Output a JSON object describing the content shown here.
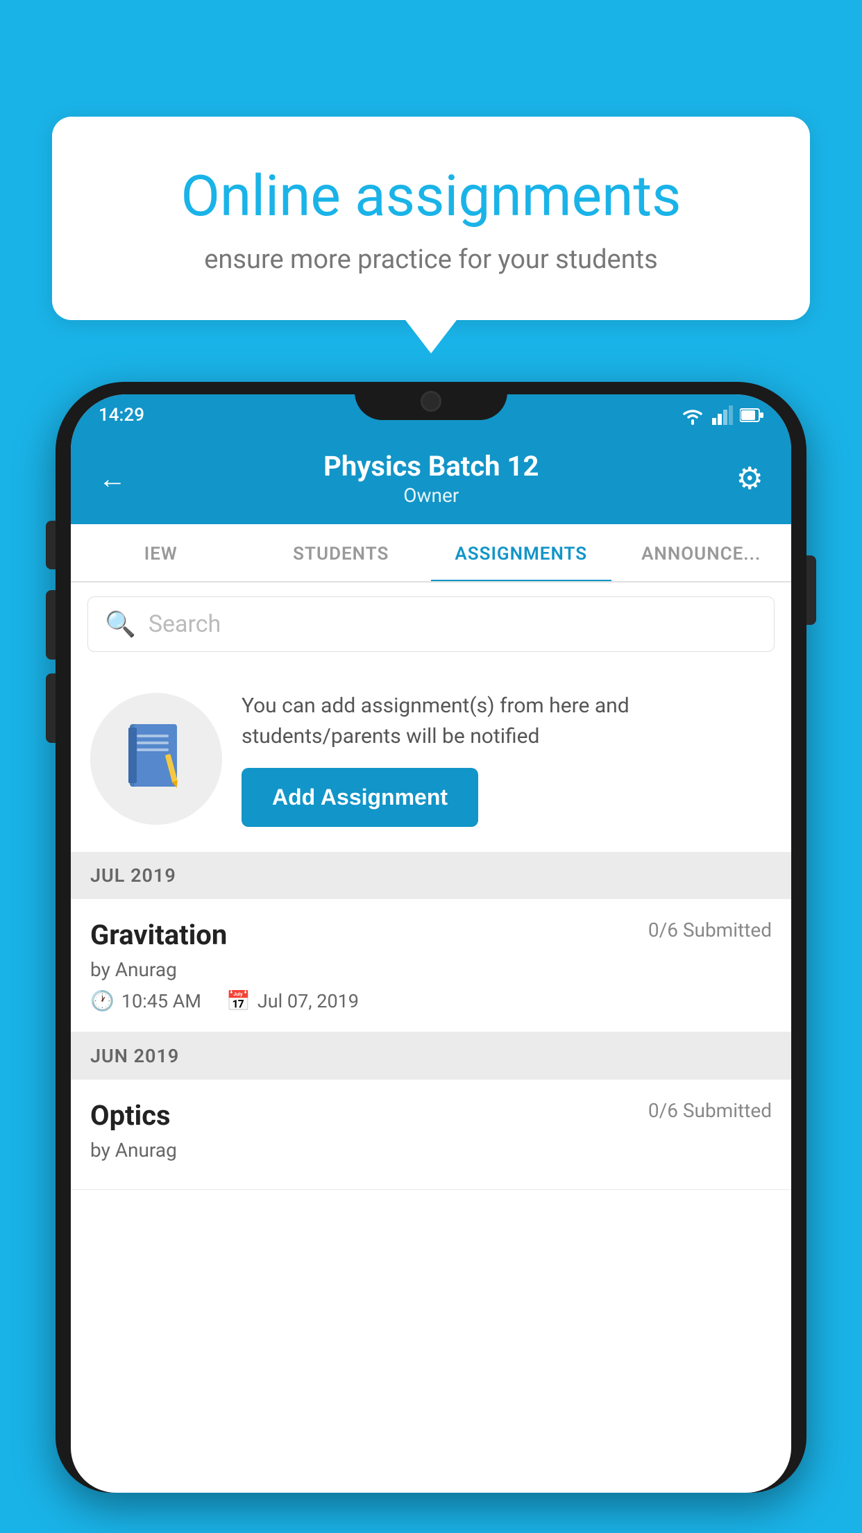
{
  "promo": {
    "title": "Online assignments",
    "subtitle": "ensure more practice for your students"
  },
  "status_bar": {
    "time": "14:29"
  },
  "header": {
    "title": "Physics Batch 12",
    "subtitle": "Owner",
    "back_label": "←",
    "gear_label": "⚙"
  },
  "tabs": [
    {
      "label": "IEW",
      "active": false
    },
    {
      "label": "STUDENTS",
      "active": false
    },
    {
      "label": "ASSIGNMENTS",
      "active": true
    },
    {
      "label": "ANNOUNCEMENTS",
      "active": false
    }
  ],
  "search": {
    "placeholder": "Search"
  },
  "empty_promo": {
    "description": "You can add assignment(s) from here and students/parents will be notified",
    "button_label": "Add Assignment"
  },
  "sections": [
    {
      "label": "JUL 2019",
      "items": [
        {
          "name": "Gravitation",
          "submitted": "0/6 Submitted",
          "by": "by Anurag",
          "time": "10:45 AM",
          "date": "Jul 07, 2019"
        }
      ]
    },
    {
      "label": "JUN 2019",
      "items": [
        {
          "name": "Optics",
          "submitted": "0/6 Submitted",
          "by": "by Anurag",
          "time": "",
          "date": ""
        }
      ]
    }
  ]
}
